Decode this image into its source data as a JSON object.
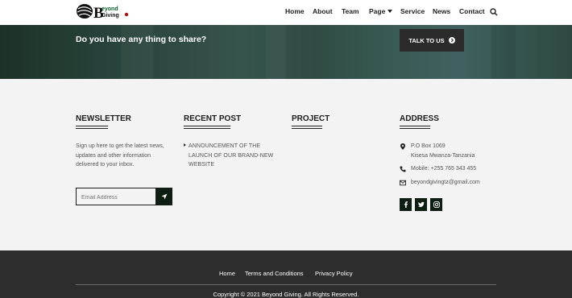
{
  "header": {
    "logo_text": "Beyond Giving",
    "nav": [
      {
        "label": "Home"
      },
      {
        "label": "About"
      },
      {
        "label": "Team"
      },
      {
        "label": "Page"
      },
      {
        "label": "Service"
      },
      {
        "label": "News"
      },
      {
        "label": "Contact"
      }
    ]
  },
  "cta": {
    "text": "Do you have any thing to share?",
    "button_label": "TALK TO US"
  },
  "newsletter": {
    "title": "NEWSLETTER",
    "text": "Sign up here to get the latest news, updates and other information delivered to your inbox.",
    "email_placeholder": "Email Address"
  },
  "recent_post": {
    "title": "RECENT POST",
    "posts": [
      "ANNOUNCEMENT OF THE LAUNCH OF OUR BRAND-NEW WEBSITE"
    ]
  },
  "project": {
    "title": "PROJECT"
  },
  "address": {
    "title": "ADDRESS",
    "location_line1": "P.O Box 1069",
    "location_line2": "Kisesa Mwanza-Tanzania",
    "mobile": "Mobile: +255 765 343 455",
    "email": "beyondgivingtz@gmail.com",
    "social": [
      "facebook-icon",
      "twitter-icon",
      "instagram-icon"
    ]
  },
  "footer": {
    "links": [
      "Home",
      "Terms and Conditions",
      "Privacy Policy"
    ],
    "copyright": "Copyright © 2021 Beyond Giving. All Rights Reserved."
  },
  "colors": {
    "dark_green": "#0e1e12",
    "footer_bg": "#2d2d2d",
    "cta_button": "#2b2b2b",
    "widgets_bg": "#f3f3f3"
  }
}
